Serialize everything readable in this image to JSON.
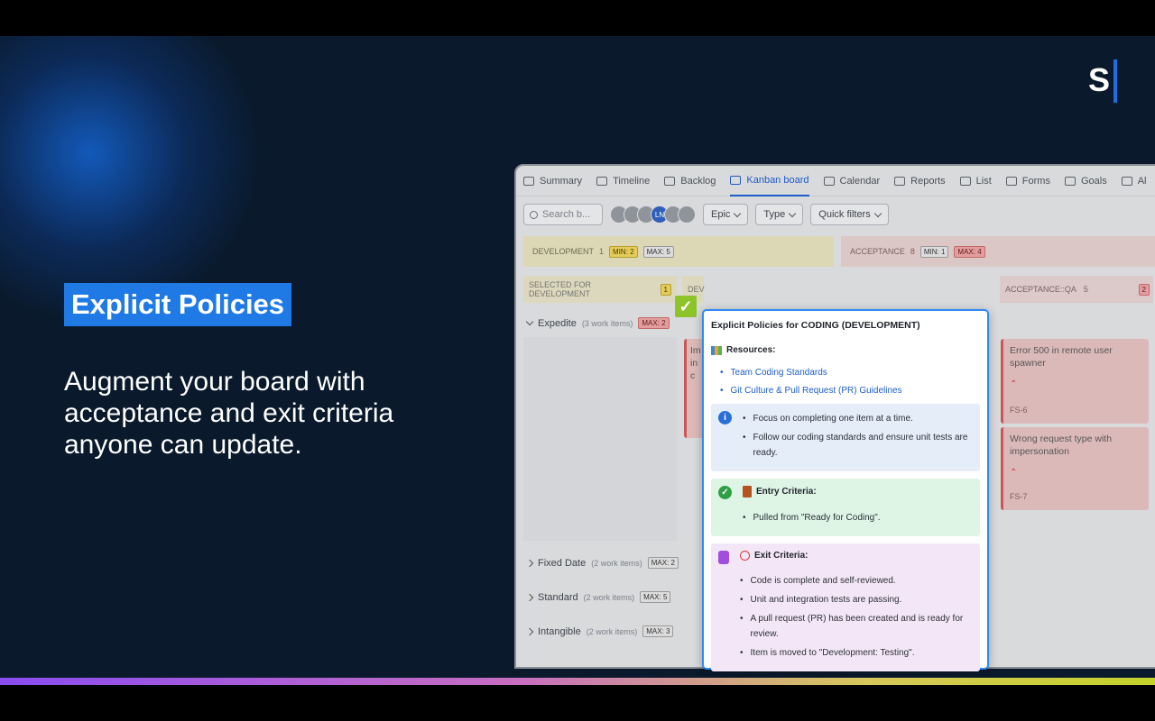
{
  "slide": {
    "brand_letter": "S",
    "pill_text": "Explicit Policies",
    "headline": "Augment your board with acceptance and exit criteria anyone can update."
  },
  "app": {
    "tabs": [
      {
        "label": "Summary"
      },
      {
        "label": "Timeline"
      },
      {
        "label": "Backlog"
      },
      {
        "label": "Kanban board",
        "active": true
      },
      {
        "label": "Calendar"
      },
      {
        "label": "Reports"
      },
      {
        "label": "List"
      },
      {
        "label": "Forms"
      },
      {
        "label": "Goals"
      },
      {
        "label": "Al"
      }
    ],
    "search_placeholder": "Search b...",
    "avatars": [
      "",
      "",
      "",
      "LN",
      "",
      ""
    ],
    "filters": {
      "epic": "Epic",
      "type": "Type",
      "quick": "Quick filters"
    },
    "columns": {
      "development": {
        "label": "DEVELOPMENT",
        "count": "1",
        "min": "MIN: 2",
        "max": "MAX: 5"
      },
      "acceptance": {
        "label": "ACCEPTANCE",
        "count": "8",
        "min": "MIN: 1",
        "max": "MAX: 4"
      },
      "selected": {
        "label": "SELECTED FOR DEVELOPMENT",
        "count": "1"
      },
      "dev_sub": "DEV",
      "acceptance_qa": {
        "label": "ACCEPTANCE::QA",
        "count": "5",
        "extra": "2"
      }
    },
    "swimlanes": [
      {
        "label": "Expedite",
        "items": "(3 work items)",
        "max": "MAX: 2"
      },
      {
        "label": "Fixed Date",
        "items": "(2 work items)",
        "max": "MAX: 2"
      },
      {
        "label": "Standard",
        "items": "(2 work items)",
        "max": "MAX: 5"
      },
      {
        "label": "Intangible",
        "items": "(2 work items)",
        "max": "MAX: 3"
      }
    ],
    "cards": [
      {
        "title": "Error 500 in remote user spawner",
        "id": "FS-6"
      },
      {
        "title": "Wrong request type with impersonation",
        "id": "FS-7"
      }
    ],
    "partial_card": {
      "line1": "Im",
      "line2": "in c"
    }
  },
  "popup": {
    "title": "Explicit Policies for CODING (DEVELOPMENT)",
    "resources_label": "Resources:",
    "links": [
      "Team Coding Standards",
      "Git Culture & Pull Request (PR) Guidelines"
    ],
    "info_items": [
      "Focus on completing one item at a time.",
      "Follow our coding standards and ensure unit tests are ready."
    ],
    "entry_label": "Entry Criteria:",
    "entry_items": [
      "Pulled from \"Ready for Coding\"."
    ],
    "exit_label": "Exit Criteria:",
    "exit_items": [
      "Code is complete and self-reviewed.",
      "Unit and integration tests are passing.",
      "A pull request (PR) has been created and is ready for review.",
      "Item is moved to \"Development: Testing\"."
    ]
  },
  "colors": {
    "accent": "#1f7ae6",
    "background": "#0a1a2c",
    "popup_border": "#2d8bf0"
  }
}
